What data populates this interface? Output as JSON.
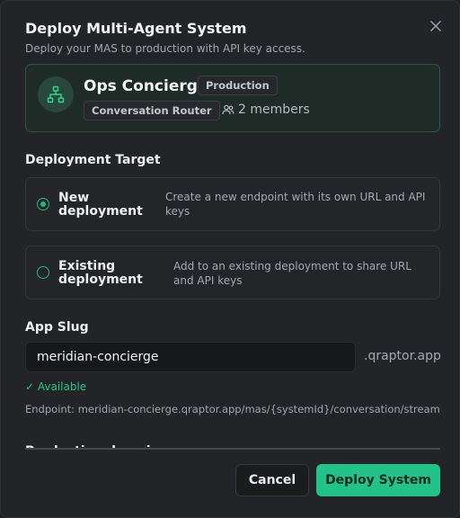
{
  "dialog": {
    "title": "Deploy Multi-Agent System",
    "subtitle": "Deploy your MAS to production with API key access."
  },
  "system": {
    "name": "Ops Concierge",
    "environment_badge": "Production",
    "type_badge": "Conversation Router",
    "members": "2 members",
    "icon": "hierarchy-icon"
  },
  "deployment_target": {
    "label": "Deployment Target",
    "options": [
      {
        "title": "New deployment",
        "description": "Create a new endpoint with its own URL and API keys",
        "selected": true
      },
      {
        "title": "Existing deployment",
        "description": "Add to an existing deployment to share URL and API keys",
        "selected": false
      }
    ]
  },
  "slug": {
    "label": "App Slug",
    "value": "meridian-concierge",
    "suffix": ".qraptor.app",
    "status": "✓ Available",
    "endpoint": "Endpoint: meridian-concierge.qraptor.app/mas/{systemId}/conversation/stream"
  },
  "next_section_label": "Production domain",
  "buttons": {
    "cancel": "Cancel",
    "deploy": "Deploy System"
  },
  "colors": {
    "accent": "#22c38a",
    "background": "#232427"
  }
}
